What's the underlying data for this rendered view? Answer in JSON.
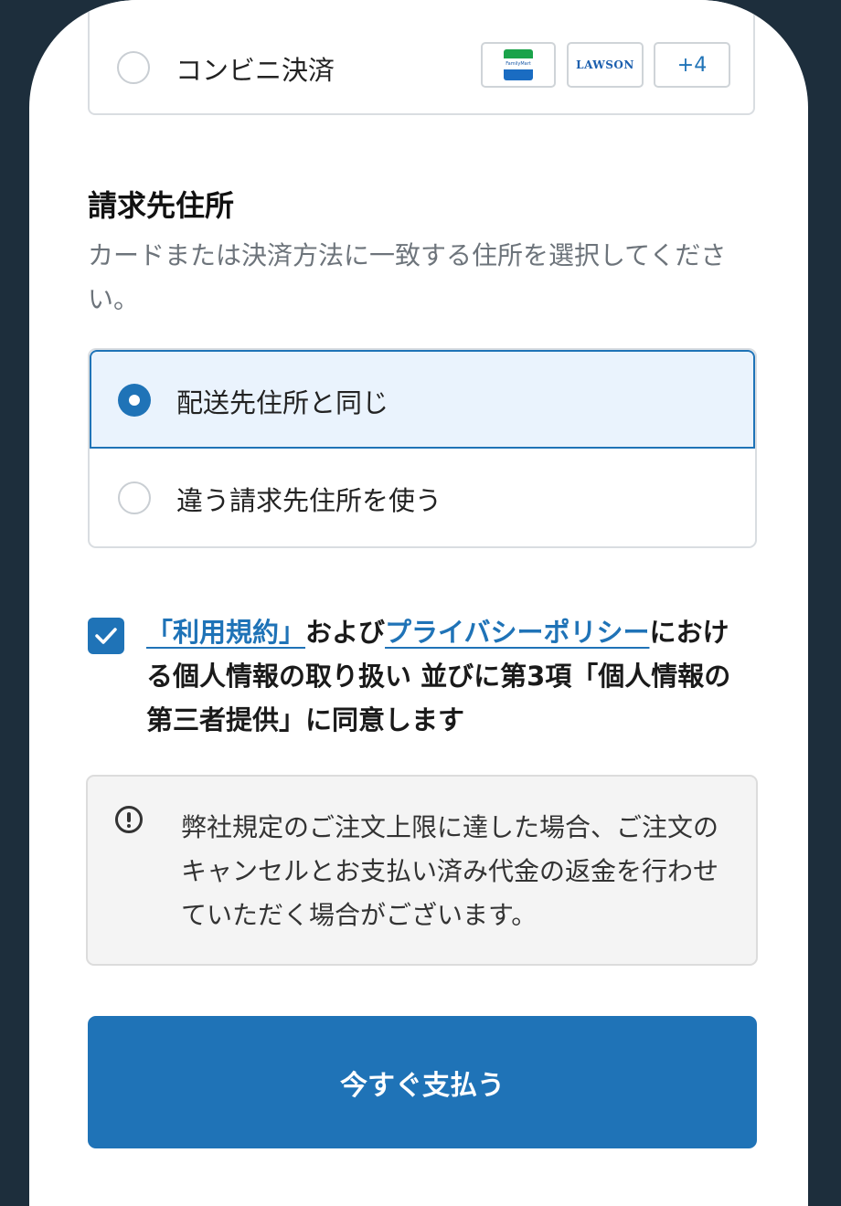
{
  "payment": {
    "option_label": "コンビニ決済",
    "brands": {
      "familymart_label": "FamilyMart",
      "lawson_label": "LAWSON",
      "more_label": "+4"
    }
  },
  "billing": {
    "title": "請求先住所",
    "description": "カードまたは決済方法に一致する住所を選択してください。",
    "options": [
      {
        "label": "配送先住所と同じ",
        "selected": true
      },
      {
        "label": "違う請求先住所を使う",
        "selected": false
      }
    ]
  },
  "consent": {
    "checked": true,
    "terms_link": "「利用規約」",
    "connector": "および",
    "privacy_link": "プライバシーポリシー",
    "text": "における個人情報の取り扱い 並びに第3項「個人情報の第三者提供」に同意します"
  },
  "notice": {
    "text": "弊社規定のご注文上限に達した場合、ご注文のキャンセルとお支払い済み代金の返金を行わせていただく場合がございます。"
  },
  "submit": {
    "label": "今すぐ支払う"
  },
  "colors": {
    "accent": "#1f73b7",
    "frame": "#1d2e3c",
    "selected_bg": "#eaf3fd"
  }
}
